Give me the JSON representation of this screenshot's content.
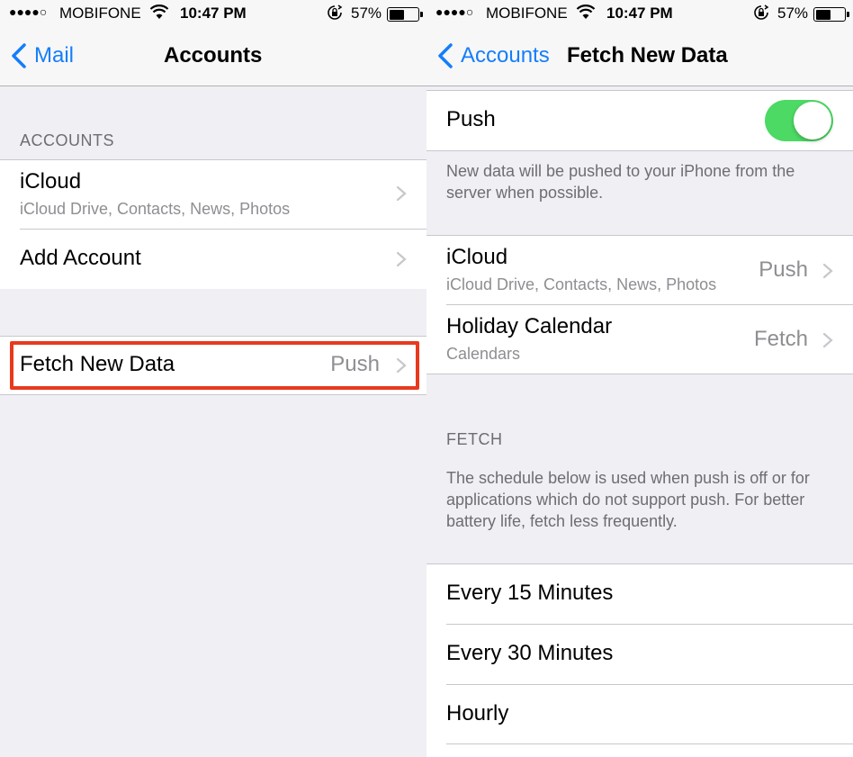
{
  "status_bar": {
    "signal": "●●●●○",
    "carrier": "MOBIFONE",
    "time": "10:47 PM",
    "battery_percent": "57%",
    "battery_level": 0.57
  },
  "left": {
    "nav": {
      "back_label": "Mail",
      "title": "Accounts"
    },
    "accounts_header": "ACCOUNTS",
    "accounts": [
      {
        "label": "iCloud",
        "sub": "iCloud Drive, Contacts, News, Photos"
      },
      {
        "label": "Add Account"
      }
    ],
    "fetch_row": {
      "label": "Fetch New Data",
      "value": "Push"
    }
  },
  "right": {
    "nav": {
      "back_label": "Accounts",
      "title": "Fetch New Data"
    },
    "push": {
      "label": "Push",
      "enabled": true
    },
    "push_footer": "New data will be pushed to your iPhone from the server when possible.",
    "accounts": [
      {
        "label": "iCloud",
        "sub": "iCloud Drive, Contacts, News, Photos",
        "value": "Push"
      },
      {
        "label": "Holiday Calendar",
        "sub": "Calendars",
        "value": "Fetch"
      }
    ],
    "fetch_header": "FETCH",
    "fetch_footer": "The schedule below is used when push is off or for applications which do not support push. For better battery life, fetch less frequently.",
    "schedule": [
      {
        "label": "Every 15 Minutes"
      },
      {
        "label": "Every 30 Minutes"
      },
      {
        "label": "Hourly"
      }
    ]
  },
  "colors": {
    "accent": "#147efb",
    "toggle_on": "#4cd964",
    "highlight": "#e8391d"
  }
}
